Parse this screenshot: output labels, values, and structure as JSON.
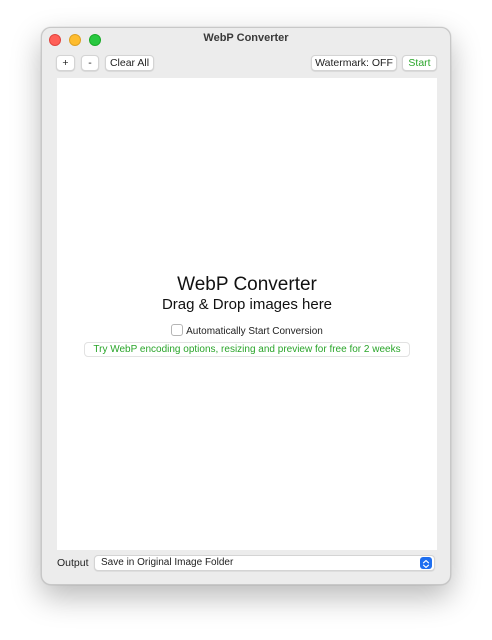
{
  "window": {
    "title": "WebP Converter"
  },
  "toolbar": {
    "add_label": "+",
    "remove_label": "-",
    "clear_all_label": "Clear All",
    "watermark_label": "Watermark: OFF",
    "start_label": "Start"
  },
  "dropzone": {
    "title": "WebP Converter",
    "subtitle": "Drag & Drop images here",
    "auto_start_label": "Automatically Start Conversion",
    "auto_start_checked": false,
    "trial_link": "Try WebP encoding options, resizing and preview for free for 2 weeks"
  },
  "footer": {
    "output_label": "Output",
    "output_selected": "Save in Original Image Folder"
  },
  "colors": {
    "accent_green": "#2aa52a",
    "select_blue": "#1f6ff0"
  }
}
